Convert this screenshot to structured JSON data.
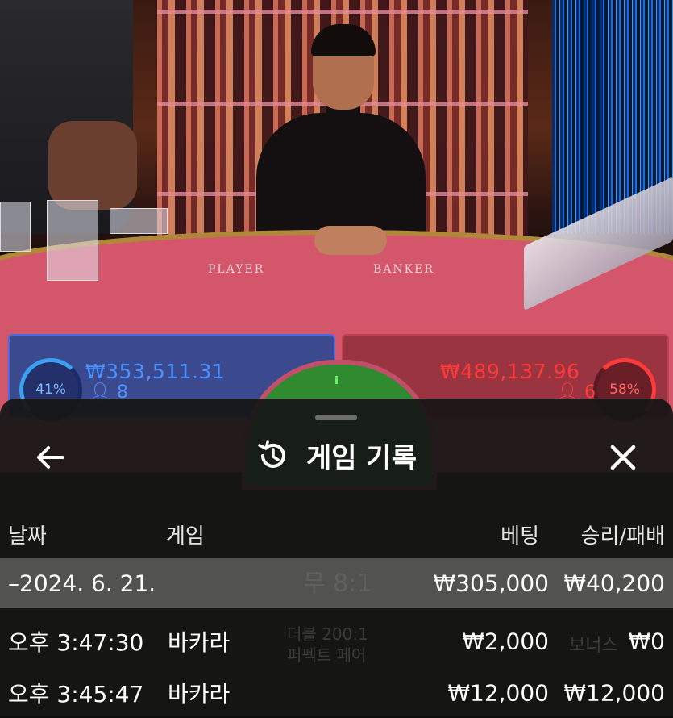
{
  "scene": {
    "table_labels": {
      "player": "PLAYER",
      "banker": "BANKER"
    },
    "player": {
      "percent": "41%",
      "amount": "₩353,511.31",
      "count": "8",
      "color": "#4a90ff"
    },
    "banker": {
      "percent": "58%",
      "amount": "₩489,137.96",
      "count": "6",
      "color": "#ff3a3a"
    }
  },
  "sheet": {
    "title": "게임 기록",
    "icons": {
      "back": "arrow-left-icon",
      "history": "history-icon",
      "close": "close-icon"
    },
    "columns": {
      "date": "날짜",
      "game": "게임",
      "bet": "베팅",
      "result": "승리/패배"
    },
    "summary": {
      "date": "–2024. 6. 21.",
      "bet": "₩305,000",
      "result": "₩40,200"
    },
    "rows": [
      {
        "time": "오후 3:47:30",
        "game": "바카라",
        "bet": "₩2,000",
        "result": "₩0"
      },
      {
        "time": "오후 3:45:47",
        "game": "바카라",
        "bet": "₩12,000",
        "result": "₩12,000"
      }
    ]
  }
}
